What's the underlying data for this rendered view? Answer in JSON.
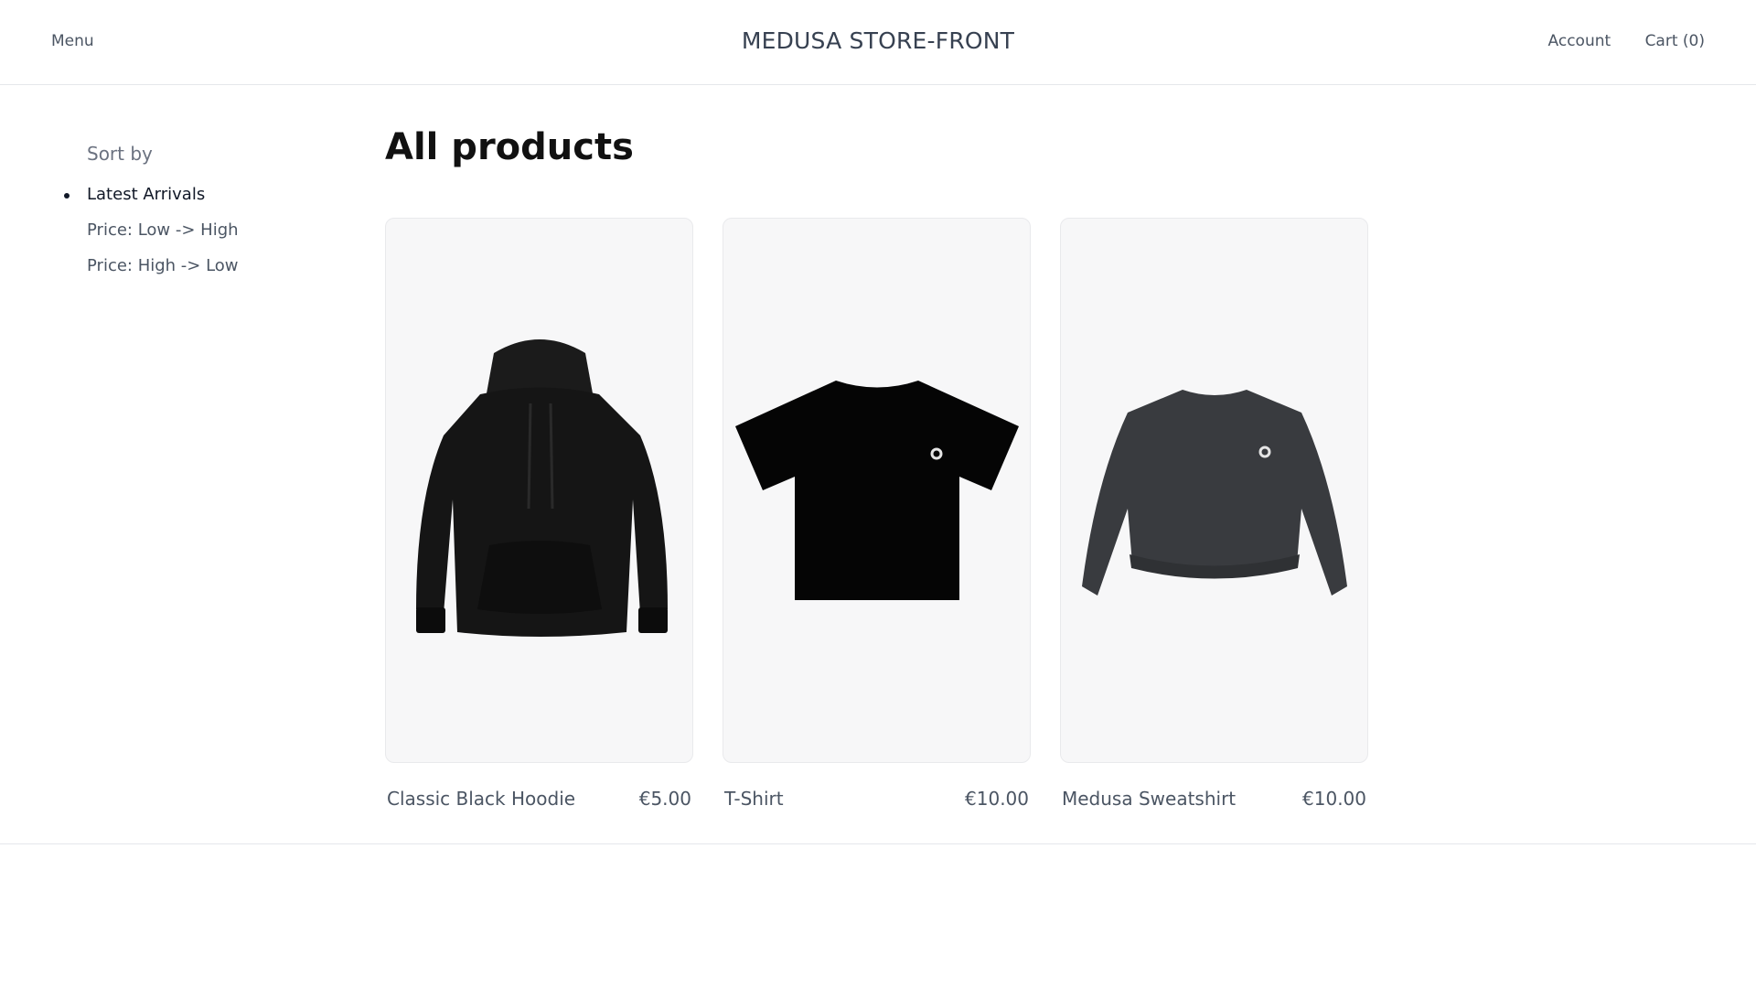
{
  "header": {
    "menu_label": "Menu",
    "brand": "MEDUSA STORE-FRONT",
    "account_label": "Account",
    "cart_label": "Cart (0)"
  },
  "sidebar": {
    "sort_title": "Sort by",
    "options": [
      {
        "label": "Latest Arrivals",
        "selected": true
      },
      {
        "label": "Price: Low -> High",
        "selected": false
      },
      {
        "label": "Price: High -> Low",
        "selected": false
      }
    ]
  },
  "main": {
    "title": "All products",
    "products": [
      {
        "name": "Classic Black Hoodie",
        "price": "€5.00",
        "image": "black-hoodie"
      },
      {
        "name": "T-Shirt",
        "price": "€10.00",
        "image": "black-tshirt"
      },
      {
        "name": "Medusa Sweatshirt",
        "price": "€10.00",
        "image": "charcoal-sweatshirt"
      }
    ]
  },
  "colors": {
    "card_bg": "#f7f7f8",
    "text_primary": "#111827",
    "text_secondary": "#4b5563"
  }
}
